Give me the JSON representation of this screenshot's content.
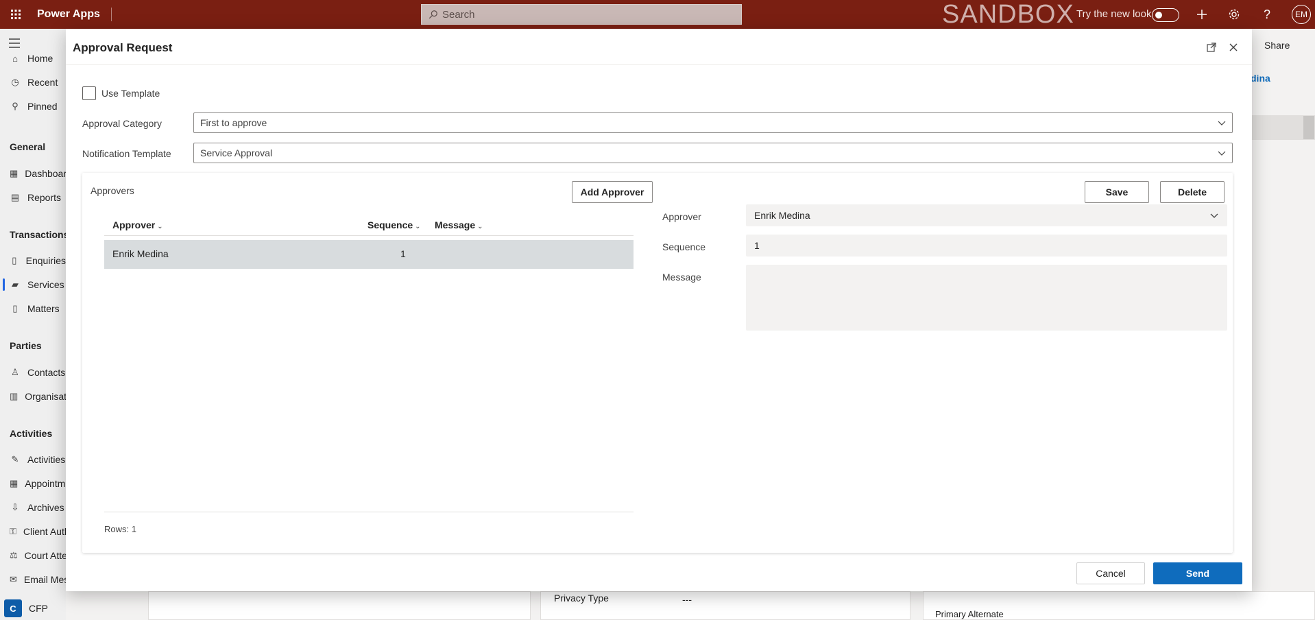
{
  "topbar": {
    "app_name": "Power Apps",
    "search_placeholder": "Search",
    "environment_label": "SANDBOX",
    "try_new_look": "Try the new look",
    "user_initials": "EM"
  },
  "sidenav": {
    "items_top": [
      {
        "label": "Home",
        "icon": "home-icon"
      },
      {
        "label": "Recent",
        "icon": "clock-icon"
      },
      {
        "label": "Pinned",
        "icon": "pin-icon"
      }
    ],
    "sections": [
      {
        "title": "General",
        "items": [
          {
            "label": "Dashboards",
            "icon": "dashboard-icon"
          },
          {
            "label": "Reports",
            "icon": "report-icon"
          }
        ]
      },
      {
        "title": "Transactions",
        "items": [
          {
            "label": "Enquiries",
            "icon": "document-icon"
          },
          {
            "label": "Services",
            "icon": "folder-icon",
            "selected": true
          },
          {
            "label": "Matters",
            "icon": "document-icon"
          }
        ]
      },
      {
        "title": "Parties",
        "items": [
          {
            "label": "Contacts",
            "icon": "person-icon"
          },
          {
            "label": "Organisations",
            "icon": "building-icon"
          }
        ]
      },
      {
        "title": "Activities",
        "items": [
          {
            "label": "Activities",
            "icon": "activity-icon"
          },
          {
            "label": "Appointments",
            "icon": "calendar-icon"
          },
          {
            "label": "Archives",
            "icon": "archive-icon"
          },
          {
            "label": "Client Auth",
            "icon": "key-icon"
          },
          {
            "label": "Court Attendance",
            "icon": "gavel-icon"
          },
          {
            "label": "Email Messages",
            "icon": "mail-icon"
          }
        ]
      }
    ],
    "area": {
      "badge": "C",
      "label": "CFP"
    }
  },
  "background": {
    "share_label": "Share",
    "owner_fragment": "dina",
    "privacy_type_label": "Privacy Type",
    "privacy_type_value": "---",
    "primary_alternate_label": "Primary Alternate"
  },
  "modal": {
    "title": "Approval Request",
    "use_template_label": "Use Template",
    "use_template_checked": false,
    "approval_category_label": "Approval Category",
    "approval_category_value": "First to approve",
    "notification_template_label": "Notification Template",
    "notification_template_value": "Service Approval",
    "approvers": {
      "title": "Approvers",
      "add_button": "Add Approver",
      "save_button": "Save",
      "delete_button": "Delete",
      "columns": [
        {
          "label": "Approver"
        },
        {
          "label": "Sequence"
        },
        {
          "label": "Message"
        }
      ],
      "rows": [
        {
          "approver": "Enrik Medina",
          "sequence": "1",
          "message": ""
        }
      ],
      "rows_count": "Rows: 1"
    },
    "detail": {
      "approver_label": "Approver",
      "approver_value": "Enrik Medina",
      "sequence_label": "Sequence",
      "sequence_value": "1",
      "message_label": "Message",
      "message_value": ""
    },
    "cancel_button": "Cancel",
    "send_button": "Send"
  },
  "colors": {
    "topbar": "#7a1f12",
    "primary": "#0f6cbd",
    "selected_row": "#d8dcde"
  }
}
